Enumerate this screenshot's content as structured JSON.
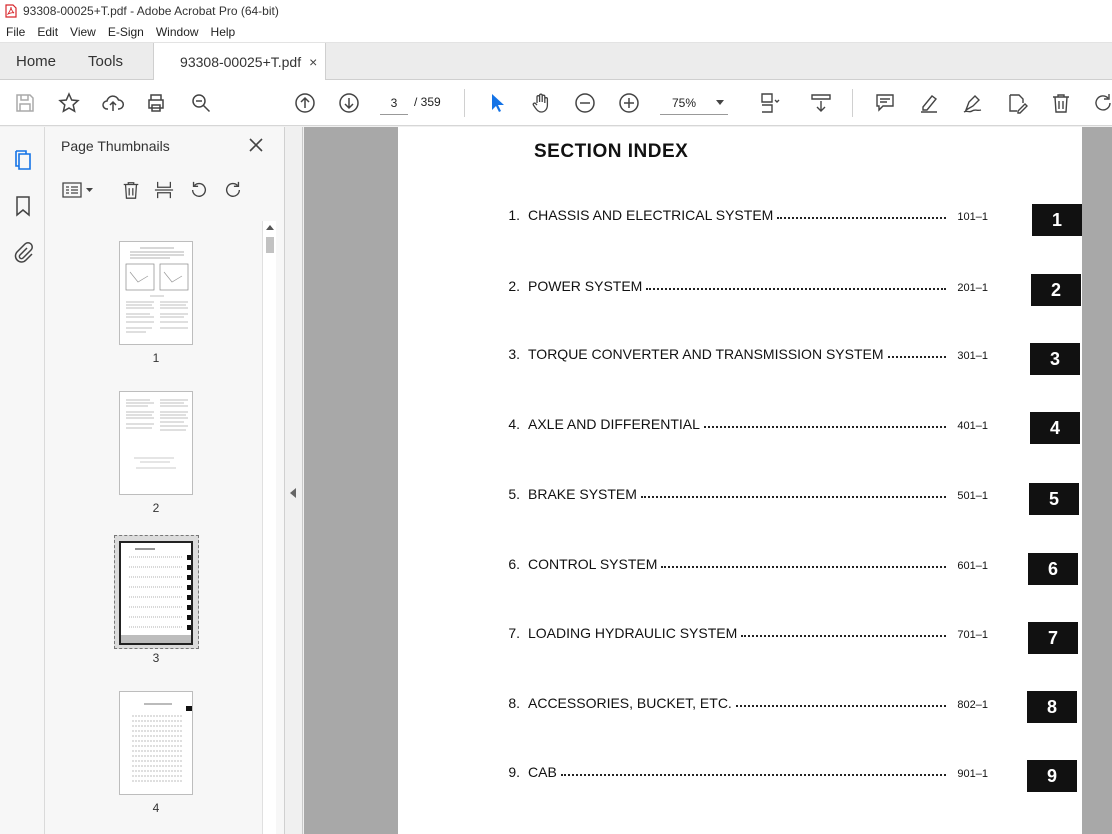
{
  "window": {
    "title": "93308-00025+T.pdf - Adobe Acrobat Pro (64-bit)"
  },
  "menu": [
    "File",
    "Edit",
    "View",
    "E-Sign",
    "Window",
    "Help"
  ],
  "tabs": {
    "home": "Home",
    "tools": "Tools",
    "document": "93308-00025+T.pdf",
    "close": "×"
  },
  "toolbar": {
    "current_page": "3",
    "total_pages": "/ 359",
    "zoom": "75%"
  },
  "panel": {
    "title": "Page Thumbnails",
    "thumbnails": [
      {
        "label": "1"
      },
      {
        "label": "2"
      },
      {
        "label": "3"
      },
      {
        "label": "4"
      }
    ]
  },
  "document": {
    "title": "SECTION INDEX",
    "entries": [
      {
        "num": "1.",
        "text": "CHASSIS AND ELECTRICAL SYSTEM",
        "page": "101–1",
        "tab": "1"
      },
      {
        "num": "2.",
        "text": "POWER SYSTEM",
        "page": "201–1",
        "tab": "2"
      },
      {
        "num": "3.",
        "text": "TORQUE CONVERTER AND TRANSMISSION SYSTEM",
        "page": "301–1",
        "tab": "3"
      },
      {
        "num": "4.",
        "text": "AXLE AND DIFFERENTIAL",
        "page": "401–1",
        "tab": "4"
      },
      {
        "num": "5.",
        "text": "BRAKE SYSTEM",
        "page": "501–1",
        "tab": "5"
      },
      {
        "num": "6.",
        "text": "CONTROL SYSTEM",
        "page": "601–1",
        "tab": "6"
      },
      {
        "num": "7.",
        "text": "LOADING HYDRAULIC SYSTEM",
        "page": "701–1",
        "tab": "7"
      },
      {
        "num": "8.",
        "text": "ACCESSORIES, BUCKET, ETC.",
        "page": "802–1",
        "tab": "8"
      },
      {
        "num": "9.",
        "text": "CAB",
        "page": "901–1",
        "tab": "9"
      }
    ]
  },
  "colors": {
    "accent": "#1473e6",
    "pdf_red": "#d7262b"
  }
}
